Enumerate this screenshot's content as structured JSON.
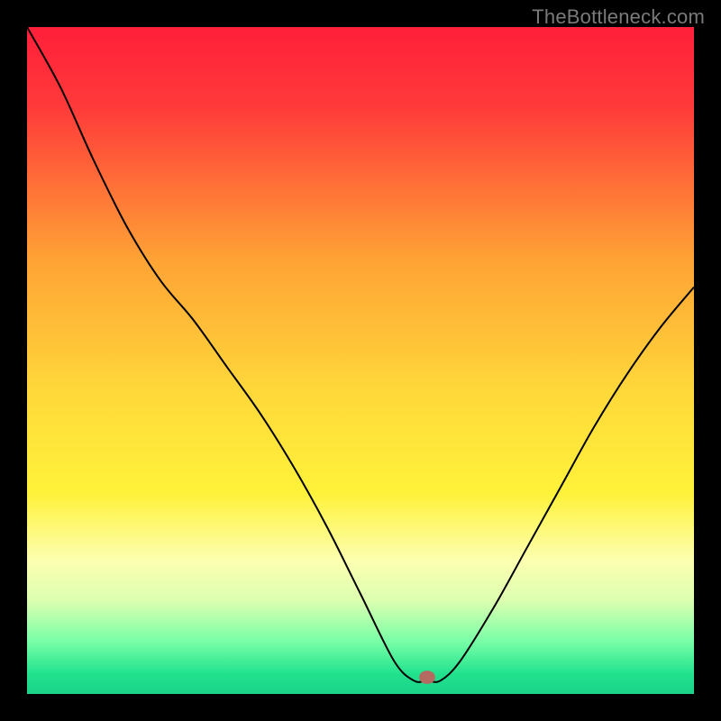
{
  "watermark": "TheBottleneck.com",
  "chart_data": {
    "type": "line",
    "title": "",
    "xlabel": "",
    "ylabel": "",
    "xlim": [
      0,
      100
    ],
    "ylim": [
      0,
      100
    ],
    "gradient_stops": [
      {
        "offset": 0,
        "color": "#ff1f3a"
      },
      {
        "offset": 12,
        "color": "#ff3a3a"
      },
      {
        "offset": 35,
        "color": "#ffa335"
      },
      {
        "offset": 55,
        "color": "#ffd93a"
      },
      {
        "offset": 70,
        "color": "#fff23a"
      },
      {
        "offset": 80,
        "color": "#fcffb0"
      },
      {
        "offset": 86,
        "color": "#dcffb0"
      },
      {
        "offset": 92,
        "color": "#7affa7"
      },
      {
        "offset": 97,
        "color": "#21e28e"
      },
      {
        "offset": 100,
        "color": "#1ad289"
      }
    ],
    "series": [
      {
        "name": "curve",
        "x": [
          0,
          5,
          10,
          15,
          20,
          25,
          30,
          35,
          40,
          45,
          50,
          55,
          58,
          60,
          62,
          65,
          70,
          75,
          80,
          85,
          90,
          95,
          100
        ],
        "y": [
          100,
          91,
          80,
          70,
          62,
          56,
          49,
          42,
          34,
          25,
          15,
          5,
          2,
          2,
          2,
          5,
          13,
          22,
          31,
          40,
          48,
          55,
          61
        ]
      }
    ],
    "marker": {
      "x": 60,
      "y": 2.5,
      "rx": 1.2,
      "ry": 1.0,
      "color": "#b46a60"
    },
    "colors": {
      "curve": "#000000",
      "frame": "#000000",
      "background": "#000000"
    }
  }
}
